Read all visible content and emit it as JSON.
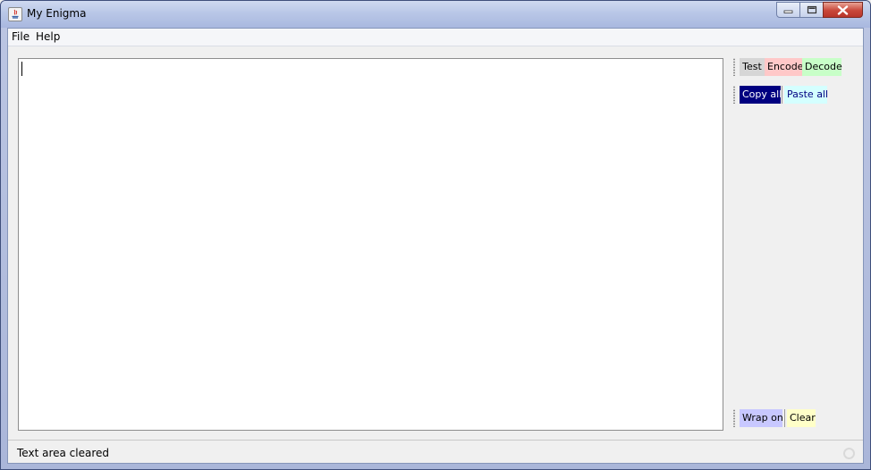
{
  "window": {
    "title": "My Enigma"
  },
  "menu": {
    "items": [
      {
        "label": "File"
      },
      {
        "label": "Help"
      }
    ]
  },
  "toolbar_top": {
    "buttons": [
      {
        "label": "Test",
        "color": "#d6d6d6"
      },
      {
        "label": "Encode",
        "color": "#ffc8c8"
      },
      {
        "label": "Decode",
        "color": "#c8ffc8"
      }
    ]
  },
  "toolbar_clipboard": {
    "buttons": [
      {
        "label": "Copy all",
        "color": "#000080",
        "text_color": "#ffffff"
      },
      {
        "label": "Paste all",
        "color": "#d4ffff",
        "text_color": "#000080"
      }
    ]
  },
  "toolbar_bottom": {
    "buttons": [
      {
        "label": "Wrap on",
        "color": "#c8c8ff"
      },
      {
        "label": "Clear",
        "color": "#ffffc8"
      }
    ]
  },
  "editor": {
    "value": ""
  },
  "status": {
    "text": "Text area cleared"
  }
}
